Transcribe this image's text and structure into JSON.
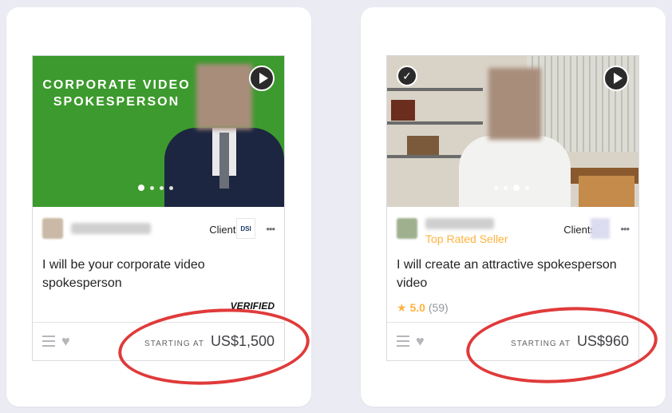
{
  "cards": [
    {
      "thumbnail_text": "CORPORATE VIDEO SPOKESPERSON",
      "clients_label": "Clients",
      "client_logo_text": "DSI",
      "title": "I will be your corporate video spokesperson",
      "verified_badge": "VERIFIED",
      "starting_at": "STARTING AT",
      "price": "US$1,500",
      "media_dots": 4,
      "active_dot": 1
    },
    {
      "top_rated": "Top Rated Seller",
      "clients_label": "Clients",
      "title": "I will create an attractive spokesperson video",
      "rating_value": "5.0",
      "rating_count": "(59)",
      "starting_at": "STARTING AT",
      "price": "US$960",
      "media_dots": 4,
      "active_dot": 3
    }
  ],
  "colors": {
    "annotation": "#e03a3a",
    "accent": "#ffb33e"
  },
  "icons": [
    "play-icon",
    "check-icon",
    "list-icon",
    "heart-icon",
    "more-icon",
    "star-icon"
  ]
}
